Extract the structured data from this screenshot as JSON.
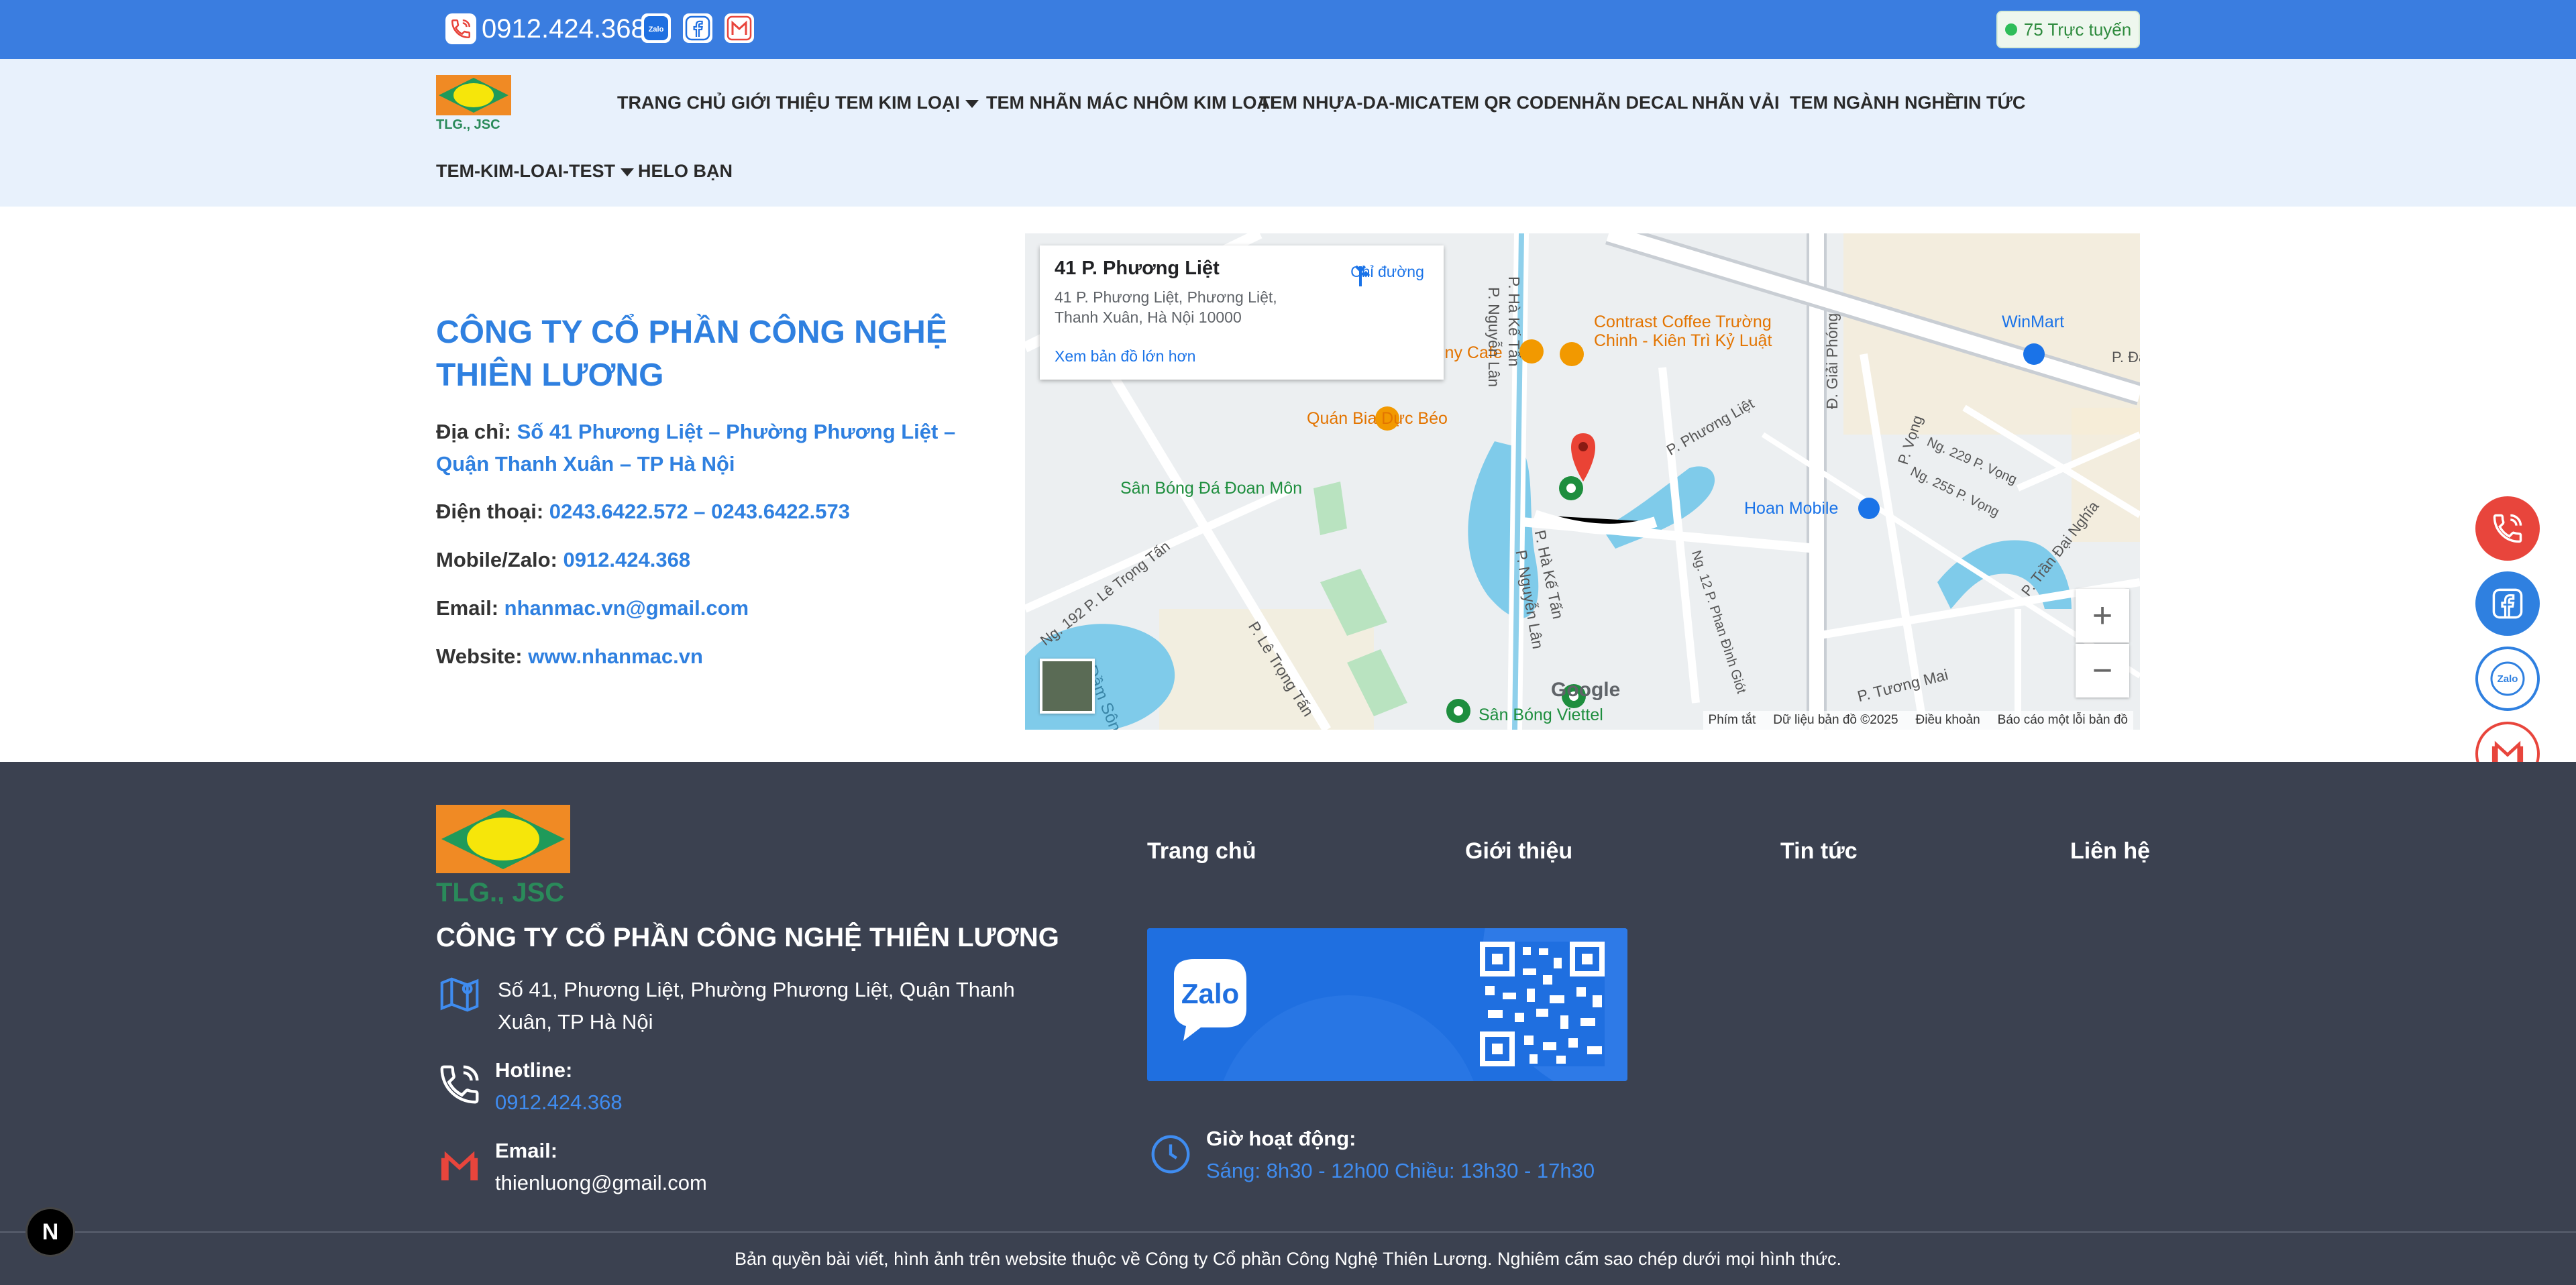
{
  "topbar": {
    "phone": "0912.424.368",
    "social_icons": [
      "zalo-icon",
      "facebook-icon",
      "gmail-icon"
    ],
    "online_label": "75 Trực tuyến"
  },
  "nav": {
    "logo_text": "TLG., JSC",
    "items": [
      {
        "label": "TRANG CHỦ"
      },
      {
        "label": "GIỚI THIỆU"
      },
      {
        "label": "TEM KIM LOẠI",
        "dropdown": true
      },
      {
        "label": "TEM NHÃN MÁC NHÔM KIM LOẠI"
      },
      {
        "label": "TEM NHỰA-DA-MICA"
      },
      {
        "label": "TEM QR CODE"
      },
      {
        "label": "NHÃN DECAL"
      },
      {
        "label": "NHÃN VẢI"
      },
      {
        "label": "TEM NGÀNH NGHỀ"
      },
      {
        "label": "TIN TỨC"
      },
      {
        "label": "TEM-KIM-LOAI-TEST",
        "dropdown": true
      },
      {
        "label": "HELO BẠN"
      }
    ]
  },
  "contact": {
    "title": "CÔNG TY CỔ PHẦN CÔNG NGHỆ THIÊN LƯƠNG",
    "address_label": "Địa chỉ:",
    "address_value": "Số 41 Phương Liệt – Phường Phương Liệt – Quận Thanh Xuân – TP Hà Nội",
    "phone_label": "Điện thoại:",
    "phone_value": "0243.6422.572 – 0243.6422.573",
    "mobile_label": "Mobile/Zalo:",
    "mobile_value": "0912.424.368",
    "email_label": "Email:",
    "email_value": "nhanmac.vn@gmail.com",
    "website_label": "Website:",
    "website_value": "www.nhanmac.vn"
  },
  "map": {
    "place_title": "41 P. Phương Liệt",
    "place_address": "41 P. Phương Liệt, Phương Liệt, Thanh Xuân, Hà Nội 10000",
    "directions": "Chỉ đường",
    "larger_map": "Xem bản đồ lớn hơn",
    "google": "Google",
    "labels": {
      "contrast": "Contrast Coffee Trường Chinh - Kiên Trì Kỷ Luật",
      "tiny": "iny Cafe",
      "bia": "Quán Bia Dực Béo",
      "sanbong_doan": "Sân Bóng Đá Đoan Môn",
      "sanbong_viettel": "Sân Bóng Viettel",
      "winmart": "WinMart",
      "hoan": "Hoan Mobile",
      "dam": "Đầm Sông",
      "hakette": "P. Hà Kế Tấn",
      "nguyenlan": "P. Nguyễn Lân",
      "giaiphong": "Đ. Giải Phóng",
      "phuongliet": "P. Phương Liệt",
      "letrongtan": "P. Lê Trọng Tấn",
      "ng192": "Ng. 192 P. Lê Trọng Tấn",
      "tuongmai": "P. Tương Mai",
      "vong": "P. Vọng",
      "trandainghia": "P. Trần Đại Nghĩa",
      "ng229": "Ng. 229 P. Vọng",
      "ng255": "Ng. 255 P. Vọng",
      "ng12": "Ng. 12 P. Phan Đình Giót",
      "pdai": "P. Đạ"
    },
    "footer_items": [
      "Phím tắt",
      "Dữ liệu bản đồ ©2025",
      "Điều khoản",
      "Báo cáo một lỗi bản đồ"
    ]
  },
  "fabs": [
    "phone-icon",
    "facebook-icon",
    "zalo-icon",
    "gmail-icon"
  ],
  "fab_zalo_text": "Zalo",
  "footer": {
    "logo_text": "TLG., JSC",
    "company": "CÔNG TY CỔ PHẦN CÔNG NGHỆ THIÊN LƯƠNG",
    "address": "Số 41, Phương Liệt, Phường Phương Liệt, Quận Thanh Xuân, TP Hà Nội",
    "hotline_label": "Hotline:",
    "hotline_value": "0912.424.368",
    "email_label": "Email:",
    "email_value": "thienluong@gmail.com",
    "nav": [
      "Trang chủ",
      "Giới thiệu",
      "Tin tức",
      "Liên hệ"
    ],
    "zalo_text": "Zalo",
    "hours_label": "Giờ hoạt động:",
    "hours_value": "Sáng: 8h30 - 12h00 Chiều: 13h30 - 17h30",
    "copyright": "Bản quyền bài viết, hình ảnh trên website thuộc về Công ty Cổ phần Công Nghệ Thiên Lương. Nghiêm cấm sao chép dưới mọi hình thức."
  },
  "dev_badge": "N",
  "colors": {
    "topbar": "#3a7de0",
    "nav_bg": "#e8f1fc",
    "accent_blue": "#2f80e0",
    "footer_bg": "#3b4150",
    "fab_red": "#e8453c",
    "fab_blue": "#2f80e0"
  }
}
